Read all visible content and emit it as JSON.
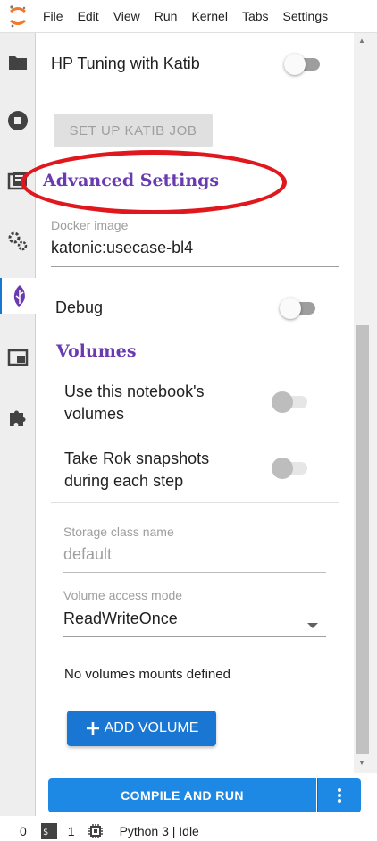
{
  "menubar": {
    "items": [
      "File",
      "Edit",
      "View",
      "Run",
      "Kernel",
      "Tabs",
      "Settings"
    ]
  },
  "sidebar": {
    "icons": [
      "folder-icon",
      "stop-circle-icon",
      "commands-icon",
      "gears-icon",
      "kale-leaf-icon",
      "tabs-icon",
      "puzzle-icon"
    ],
    "active": "kale-leaf-icon"
  },
  "hp_tuning": {
    "label": "HP Tuning with Katib",
    "enabled": false,
    "setup_button": "SET UP KATIB JOB"
  },
  "advanced": {
    "title": "Advanced Settings",
    "docker_label": "Docker image",
    "docker_value": "katonic:usecase-bl4",
    "debug_label": "Debug",
    "debug_enabled": false
  },
  "volumes": {
    "title": "Volumes",
    "use_notebook_volumes_line1": "Use this notebook's",
    "use_notebook_volumes_line2": "volumes",
    "rok_snapshots_line1": "Take Rok snapshots",
    "rok_snapshots_line2": "during each step",
    "storage_class_label": "Storage class name",
    "storage_class_value": "default",
    "access_mode_label": "Volume access mode",
    "access_mode_value": "ReadWriteOnce",
    "empty_message": "No volumes mounts defined",
    "add_button": "ADD VOLUME"
  },
  "footer": {
    "compile_button": "COMPILE AND RUN"
  },
  "statusbar": {
    "terminals": "0",
    "kernels": "1",
    "kernel_status": "Python 3 | Idle"
  },
  "colors": {
    "accent": "#1976d2",
    "section_title": "#6a3ab0",
    "highlight_ellipse": "#e0181e"
  }
}
